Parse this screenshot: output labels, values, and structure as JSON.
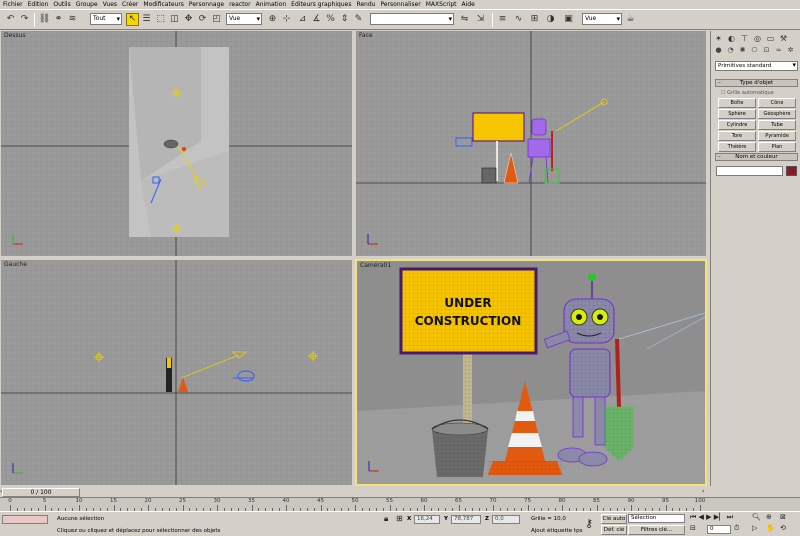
{
  "menu": [
    "Fichier",
    "Edition",
    "Outils",
    "Groupe",
    "Vues",
    "Créer",
    "Modificateurs",
    "Personnage",
    "reactor",
    "Animation",
    "Editeurs graphiques",
    "Rendu",
    "Personnaliser",
    "MAXScript",
    "Aide"
  ],
  "toolbar": {
    "selection_filter": "Tout",
    "reference_coord": "Vue",
    "named_selection": "",
    "render_type": "Vue"
  },
  "viewports": {
    "top": "Dessus",
    "front": "Face",
    "left": "Gauche",
    "perspective": "Caméra01"
  },
  "scene": {
    "sign_line1": "UNDER",
    "sign_line2": "CONSTRUCTION"
  },
  "command_panel": {
    "category": "Primitives standard",
    "object_type_header": "Type d'objet",
    "autogrid": "Grille automatique",
    "buttons": [
      "Boîte",
      "Cône",
      "Sphère",
      "Géosphère",
      "Cylindre",
      "Tube",
      "Tore",
      "Pyramide",
      "Théière",
      "Plan"
    ],
    "name_color_header": "Nom et couleur",
    "object_color": "#8a1a28"
  },
  "timeline": {
    "frame_display": "0 / 100",
    "ticks": [
      0,
      5,
      10,
      15,
      20,
      25,
      30,
      35,
      40,
      45,
      50,
      55,
      60,
      65,
      70,
      75,
      80,
      85,
      90,
      95,
      100
    ]
  },
  "status": {
    "selection": "Aucune sélection",
    "prompt": "Cliquez ou cliquez et déplacez pour sélectionner des objets",
    "x_label": "X",
    "x_value": "16,24",
    "y_label": "Y",
    "y_value": "78,787",
    "z_label": "Z",
    "z_value": "0,0",
    "grid": "Grille = 10,0",
    "add_time_tag": "Ajout étiquette tps",
    "auto_key": "Clé auto",
    "set_key": "Déf. clé",
    "key_mode": "Sélection",
    "key_filters": "Filtres clé...",
    "current_frame": "0"
  },
  "colors": {
    "viewport_bg": "#9a9a9a",
    "active_border": "#f3e27a",
    "sign_yellow": "#f7c400",
    "robot_purple": "#7a2bd8",
    "cone_orange": "#e25a10",
    "shovel_green": "#30d030"
  }
}
